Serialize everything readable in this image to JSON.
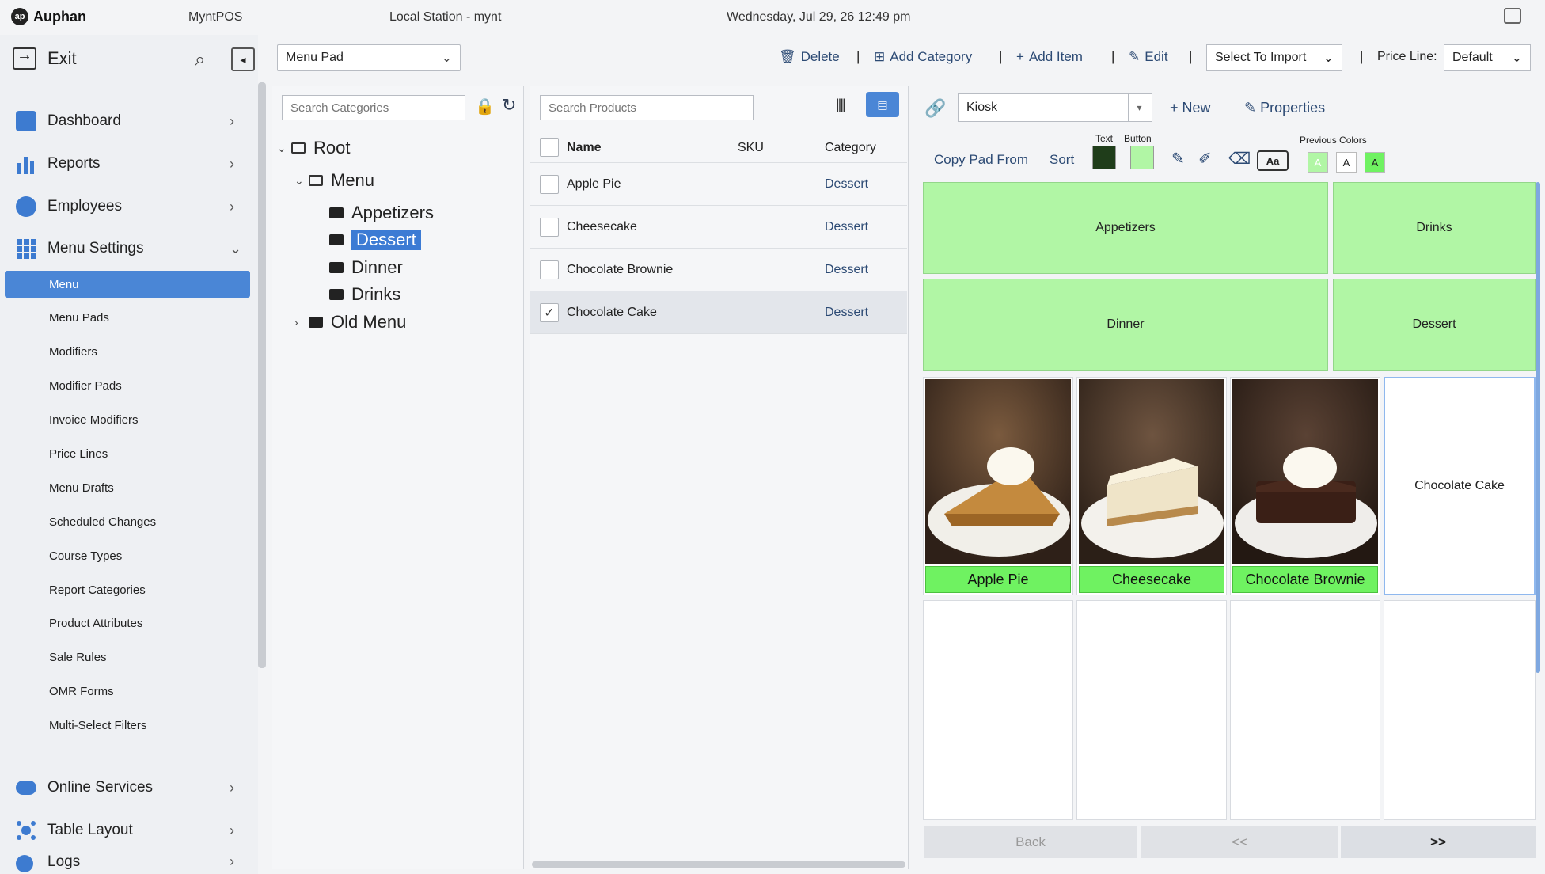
{
  "titlebar": {
    "brand": "Auphan",
    "app_name": "MyntPOS",
    "station": "Local Station - mynt",
    "datetime": "Wednesday, Jul 29, 26 12:49 pm",
    "chat_icon": "chat-icon"
  },
  "sidebar": {
    "exit_label": "Exit",
    "main_items": [
      {
        "label": "Dashboard",
        "icon": "dashboard-icon",
        "color": "#3d7bd0"
      },
      {
        "label": "Reports",
        "icon": "bar-chart-icon",
        "color": "#3d7bd0"
      },
      {
        "label": "Employees",
        "icon": "employees-icon",
        "color": "#3d7bd0"
      },
      {
        "label": "Menu Settings",
        "icon": "grid-icon",
        "color": "#3d7bd0"
      }
    ],
    "sub_items": [
      "Menu",
      "Menu Pads",
      "Modifiers",
      "Modifier Pads",
      "Invoice Modifiers",
      "Price Lines",
      "Menu Drafts",
      "Scheduled Changes",
      "Course Types",
      "Report Categories",
      "Product Attributes",
      "Sale Rules",
      "OMR Forms",
      "Multi-Select Filters"
    ],
    "active_sub": "Menu",
    "bottom_items": [
      {
        "label": "Online Services",
        "icon": "cloud-icon"
      },
      {
        "label": "Table Layout",
        "icon": "table-layout-icon"
      },
      {
        "label": "Logs",
        "icon": "logs-icon"
      }
    ]
  },
  "toolbar": {
    "menupad_value": "Menu Pad",
    "delete_label": "Delete",
    "add_category_label": "Add Category",
    "add_item_label": "Add Item",
    "edit_label": "Edit",
    "import_value": "Select To Import",
    "price_line_label": "Price Line:",
    "price_line_value": "Default"
  },
  "categories": {
    "search_placeholder": "Search Categories",
    "tree": {
      "root": "Root",
      "menu": "Menu",
      "children": [
        "Appetizers",
        "Dessert",
        "Dinner",
        "Drinks"
      ],
      "selected": "Dessert",
      "old_menu": "Old Menu"
    }
  },
  "products": {
    "search_placeholder": "Search Products",
    "columns": {
      "name": "Name",
      "sku": "SKU",
      "category": "Category"
    },
    "rows": [
      {
        "name": "Apple Pie",
        "sku": "",
        "category": "Dessert",
        "checked": false
      },
      {
        "name": "Cheesecake",
        "sku": "",
        "category": "Dessert",
        "checked": false
      },
      {
        "name": "Chocolate Brownie",
        "sku": "",
        "category": "Dessert",
        "checked": false
      },
      {
        "name": "Chocolate Cake",
        "sku": "",
        "category": "Dessert",
        "checked": true
      }
    ]
  },
  "pad": {
    "kiosk_value": "Kiosk",
    "new_label": "New",
    "properties_label": "Properties",
    "copy_pad_label": "Copy Pad From",
    "sort_label": "Sort",
    "text_label": "Text",
    "button_label": "Button",
    "text_color": "#1f3d1a",
    "button_color": "#b1f6a5",
    "font_btn": "Aa",
    "previous_colors_label": "Previous Colors",
    "previous_swatch_text": [
      "A",
      "A",
      "A"
    ],
    "category_buttons": [
      "Appetizers",
      "Drinks",
      "Dinner",
      "Dessert"
    ],
    "items": [
      {
        "label": "Apple Pie",
        "has_image": true
      },
      {
        "label": "Cheesecake",
        "has_image": true
      },
      {
        "label": "Chocolate Brownie",
        "has_image": true
      },
      {
        "label": "Chocolate Cake",
        "has_image": false
      }
    ],
    "back_label": "Back",
    "prev_label": "<<",
    "next_label": ">>"
  }
}
